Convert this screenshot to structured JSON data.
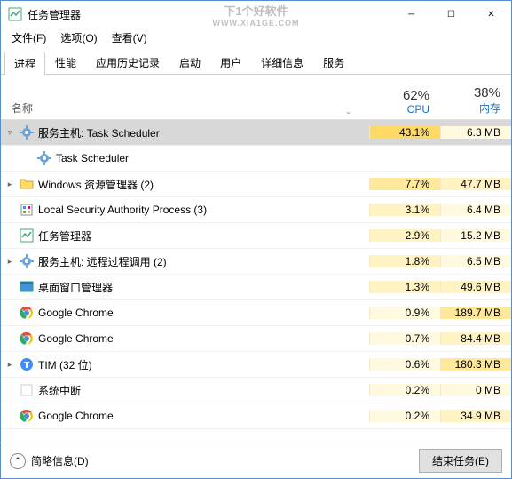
{
  "window": {
    "title": "任务管理器"
  },
  "watermark": {
    "main": "下1个好软件",
    "sub": "WWW.XIA1GE.COM"
  },
  "menu": {
    "file": "文件(F)",
    "options": "选项(O)",
    "view": "查看(V)"
  },
  "tabs": [
    "进程",
    "性能",
    "应用历史记录",
    "启动",
    "用户",
    "详细信息",
    "服务"
  ],
  "activeTab": 0,
  "columns": {
    "name": "名称",
    "cpu": {
      "pct": "62%",
      "label": "CPU"
    },
    "mem": {
      "pct": "38%",
      "label": "内存"
    }
  },
  "rows": [
    {
      "expander": "▿",
      "icon": "gear",
      "name": "服务主机: Task Scheduler",
      "cpu": "43.1%",
      "mem": "6.3 MB",
      "cpuHeat": 4,
      "memHeat": 1,
      "selected": true
    },
    {
      "child": true,
      "icon": "gear",
      "name": "Task Scheduler",
      "cpu": "",
      "mem": "",
      "cpuHeat": 0,
      "memHeat": 0
    },
    {
      "expander": "▸",
      "icon": "folder",
      "name": "Windows 资源管理器 (2)",
      "cpu": "7.7%",
      "mem": "47.7 MB",
      "cpuHeat": 3,
      "memHeat": 2
    },
    {
      "expander": "",
      "icon": "shield",
      "name": "Local Security Authority Process (3)",
      "cpu": "3.1%",
      "mem": "6.4 MB",
      "cpuHeat": 2,
      "memHeat": 1
    },
    {
      "expander": "",
      "icon": "taskmgr",
      "name": "任务管理器",
      "cpu": "2.9%",
      "mem": "15.2 MB",
      "cpuHeat": 2,
      "memHeat": 1
    },
    {
      "expander": "▸",
      "icon": "gear",
      "name": "服务主机: 远程过程调用 (2)",
      "cpu": "1.8%",
      "mem": "6.5 MB",
      "cpuHeat": 2,
      "memHeat": 1
    },
    {
      "expander": "",
      "icon": "dwm",
      "name": "桌面窗口管理器",
      "cpu": "1.3%",
      "mem": "49.6 MB",
      "cpuHeat": 2,
      "memHeat": 2
    },
    {
      "expander": "",
      "icon": "chrome",
      "name": "Google Chrome",
      "cpu": "0.9%",
      "mem": "189.7 MB",
      "cpuHeat": 1,
      "memHeat": 3
    },
    {
      "expander": "",
      "icon": "chrome",
      "name": "Google Chrome",
      "cpu": "0.7%",
      "mem": "84.4 MB",
      "cpuHeat": 1,
      "memHeat": 2
    },
    {
      "expander": "▸",
      "icon": "tim",
      "name": "TIM (32 位)",
      "cpu": "0.6%",
      "mem": "180.3 MB",
      "cpuHeat": 1,
      "memHeat": 3
    },
    {
      "expander": "",
      "icon": "blank",
      "name": "系统中断",
      "cpu": "0.2%",
      "mem": "0 MB",
      "cpuHeat": 1,
      "memHeat": 1
    },
    {
      "expander": "",
      "icon": "chrome",
      "name": "Google Chrome",
      "cpu": "0.2%",
      "mem": "34.9 MB",
      "cpuHeat": 1,
      "memHeat": 2
    }
  ],
  "footer": {
    "fewer": "简略信息(D)",
    "end": "结束任务(E)"
  }
}
